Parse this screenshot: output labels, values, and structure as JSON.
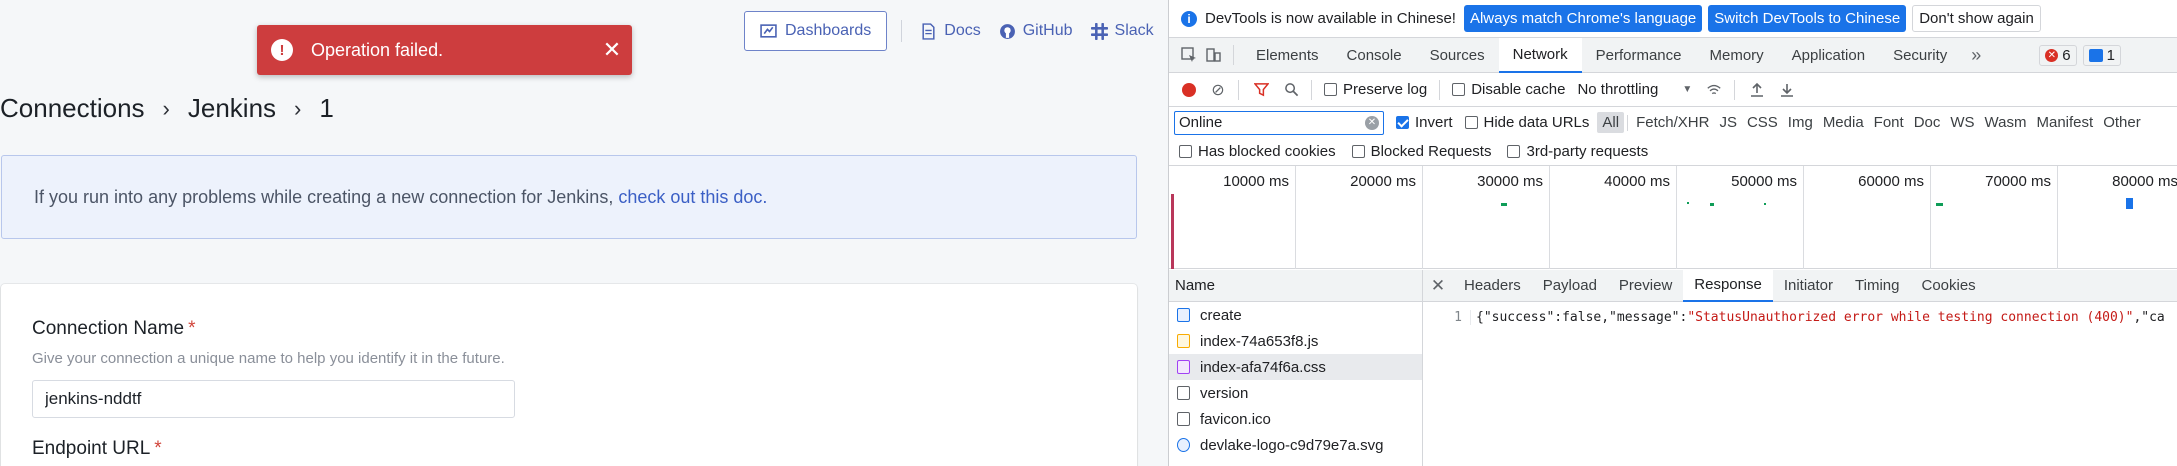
{
  "app": {
    "toast": {
      "message": "Operation failed.",
      "close": "✕",
      "icon": "!"
    },
    "nav": {
      "dashboards": "Dashboards",
      "docs": "Docs",
      "github": "GitHub",
      "slack": "Slack"
    },
    "breadcrumb": {
      "root": "Connections",
      "plugin": "Jenkins",
      "id": "1",
      "separator": "›"
    },
    "callout": {
      "text": "If you run into any problems while creating a new connection for Jenkins,",
      "link": "check out this doc."
    },
    "form": {
      "connection_name": {
        "label": "Connection Name",
        "required": "*",
        "hint": "Give your connection a unique name to help you identify it in the future.",
        "value": "jenkins-nddtf"
      },
      "endpoint_url": {
        "label": "Endpoint URL",
        "required": "*"
      }
    }
  },
  "devtools": {
    "infobar": {
      "icon": "i",
      "text": "DevTools is now available in Chinese!",
      "btn_match": "Always match Chrome's language",
      "btn_switch": "Switch DevTools to Chinese",
      "btn_dismiss": "Don't show again"
    },
    "tabs": [
      {
        "label": "Elements"
      },
      {
        "label": "Console"
      },
      {
        "label": "Sources"
      },
      {
        "label": "Network"
      },
      {
        "label": "Performance"
      },
      {
        "label": "Memory"
      },
      {
        "label": "Application"
      },
      {
        "label": "Security"
      }
    ],
    "more": "»",
    "error_count": "6",
    "message_count": "1",
    "toolbar": {
      "preserve_log": "Preserve log",
      "disable_cache": "Disable cache",
      "throttle": "No throttling",
      "throttle_caret": "▼"
    },
    "filter": {
      "value": "Online",
      "invert": "Invert",
      "hide_data_urls": "Hide data URLs",
      "types": [
        "All",
        "Fetch/XHR",
        "JS",
        "CSS",
        "Img",
        "Media",
        "Font",
        "Doc",
        "WS",
        "Wasm",
        "Manifest",
        "Other"
      ]
    },
    "block": {
      "has_blocked_cookies": "Has blocked cookies",
      "blocked_requests": "Blocked Requests",
      "third_party": "3rd-party requests"
    },
    "timeline": {
      "labels": [
        "10000 ms",
        "20000 ms",
        "30000 ms",
        "40000 ms",
        "50000 ms",
        "60000 ms",
        "70000 ms",
        "80000 ms"
      ]
    },
    "requests": {
      "header": "Name",
      "items": [
        {
          "name": "create",
          "type": "doc"
        },
        {
          "name": "index-74a653f8.js",
          "type": "js"
        },
        {
          "name": "index-afa74f6a.css",
          "type": "css"
        },
        {
          "name": "version",
          "type": "blank"
        },
        {
          "name": "favicon.ico",
          "type": "blank"
        },
        {
          "name": "devlake-logo-c9d79e7a.svg",
          "type": "img"
        }
      ]
    },
    "detail": {
      "close": "✕",
      "tabs": [
        "Headers",
        "Payload",
        "Preview",
        "Response",
        "Initiator",
        "Timing",
        "Cookies"
      ],
      "line_number": "1",
      "response_prefix": "{\"success\":false,\"message\":",
      "response_message": "\"StatusUnauthorized error while testing connection (400)\"",
      "response_suffix": ",\"ca"
    }
  },
  "colors": {
    "toast_bg": "#cd3d3e",
    "link": "#4a62b4",
    "devtools_accent": "#1a73e8",
    "record": "#d93025"
  }
}
